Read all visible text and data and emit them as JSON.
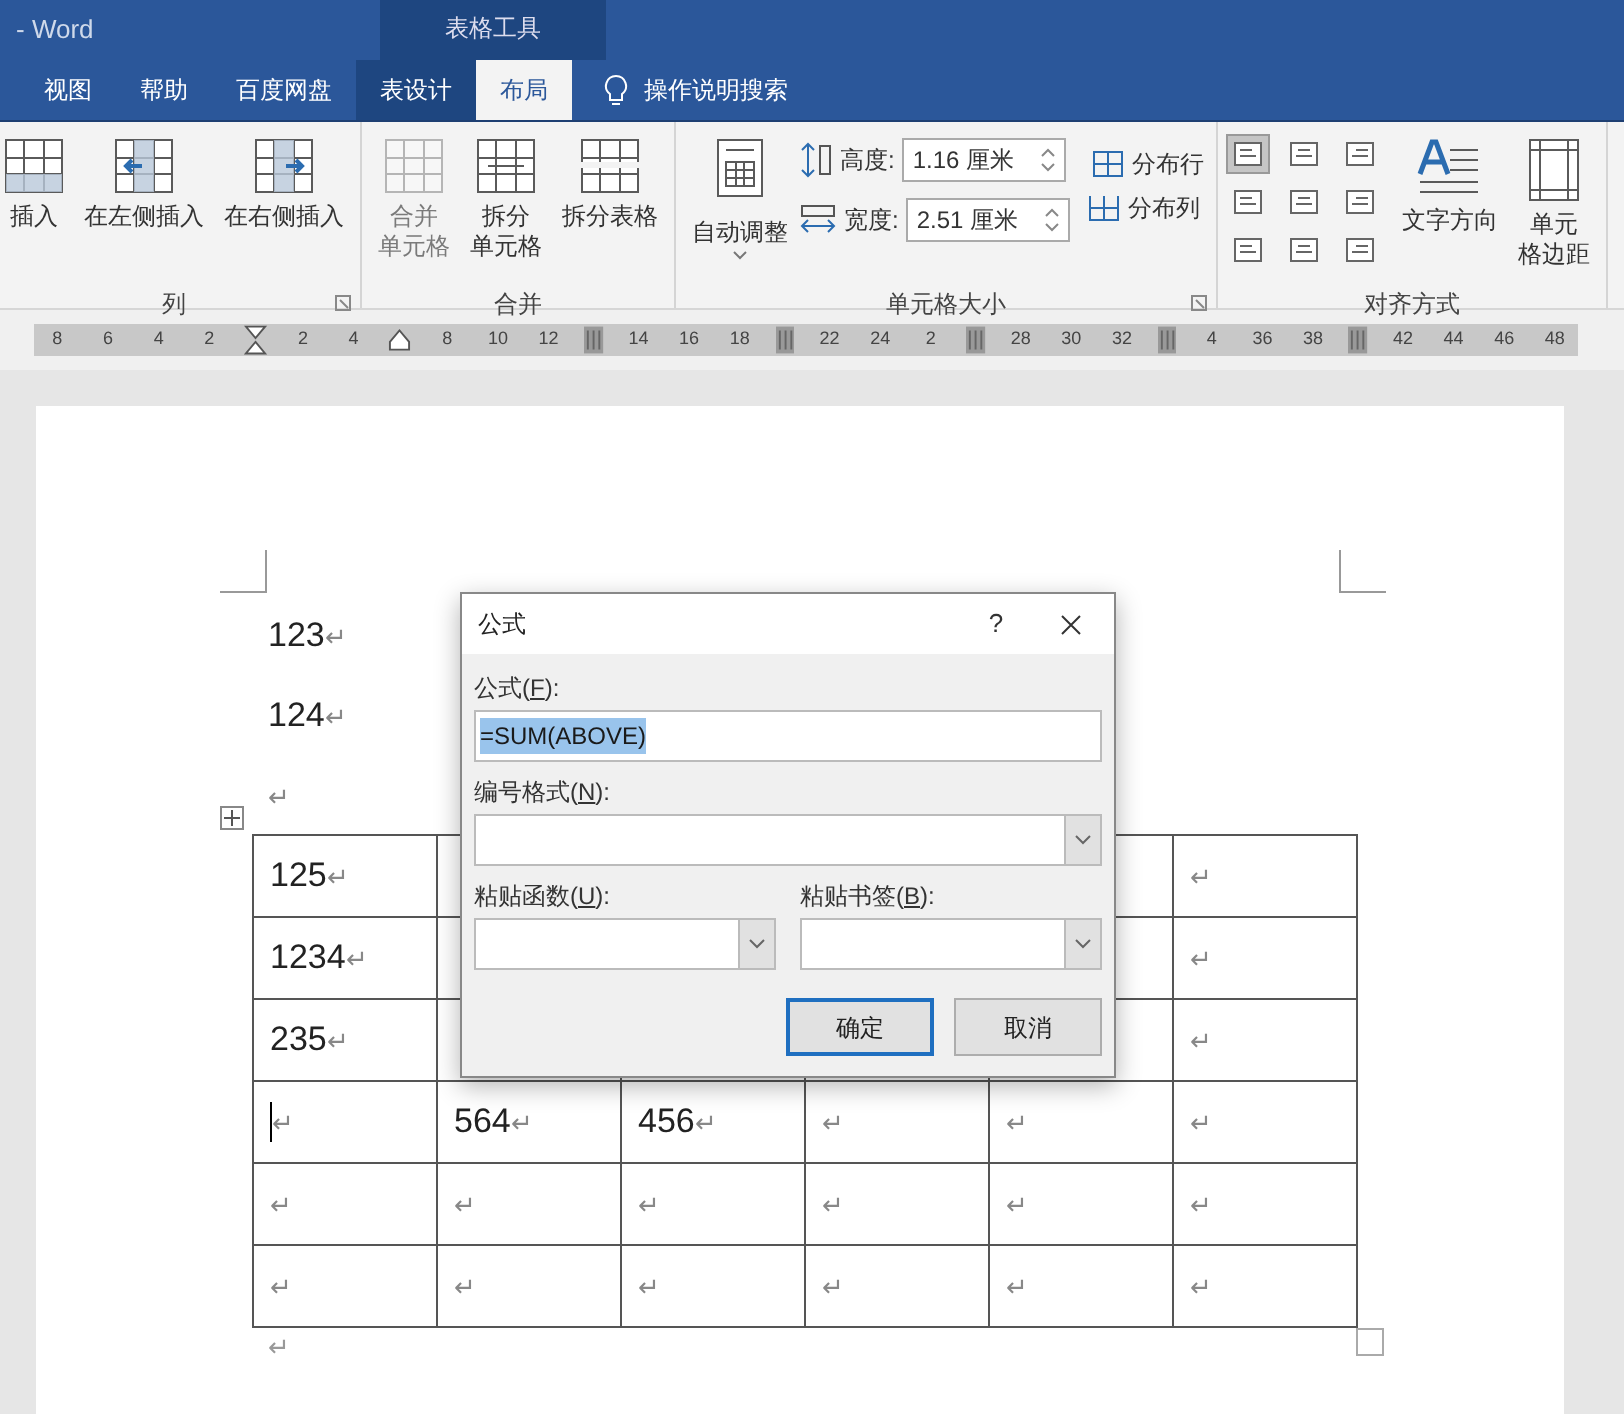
{
  "window": {
    "title": "- Word",
    "context_tab": "表格工具"
  },
  "tabs": [
    {
      "label": "视图",
      "selected": false
    },
    {
      "label": "帮助",
      "selected": false
    },
    {
      "label": "百度网盘",
      "selected": false
    },
    {
      "label": "表设计",
      "selected": false
    },
    {
      "label": "布局",
      "selected": true
    }
  ],
  "search": {
    "label": "操作说明搜索"
  },
  "ribbon": {
    "groups": [
      {
        "label": "列",
        "launcher": true,
        "items": [
          {
            "kind": "big",
            "lines": [
              "插入"
            ],
            "disabled": false
          },
          {
            "kind": "big",
            "lines": [
              "在左侧插入"
            ],
            "disabled": false
          },
          {
            "kind": "big",
            "lines": [
              "在右侧插入"
            ],
            "disabled": false
          }
        ]
      },
      {
        "label": "合并",
        "launcher": false,
        "items": [
          {
            "kind": "big",
            "lines": [
              "合并",
              "单元格"
            ],
            "disabled": true
          },
          {
            "kind": "big",
            "lines": [
              "拆分",
              "单元格"
            ],
            "disabled": false
          },
          {
            "kind": "big",
            "lines": [
              "拆分表格"
            ],
            "disabled": false
          }
        ]
      },
      {
        "label": "单元格大小",
        "launcher": true,
        "items": [
          {
            "kind": "dropdown",
            "label": "自动调整",
            "disabled": false
          },
          {
            "kind": "spinner",
            "label": "高度:",
            "value": "1.16 厘米"
          },
          {
            "kind": "spinner",
            "label": "宽度:",
            "value": "2.51 厘米"
          },
          {
            "kind": "small",
            "label": "分布行",
            "disabled": false
          },
          {
            "kind": "small",
            "label": "分布列",
            "disabled": false
          }
        ]
      },
      {
        "label": "对齐方式",
        "launcher": false,
        "items": [
          {
            "kind": "align",
            "cells": [
              true,
              false,
              false,
              false,
              false,
              false,
              false,
              false,
              false
            ]
          },
          {
            "kind": "big",
            "lines": [
              "文字方向"
            ],
            "disabled": false
          },
          {
            "kind": "big",
            "lines": [
              "单元",
              "格边距"
            ],
            "disabled": false
          }
        ]
      }
    ]
  },
  "ruler": [
    {
      "kind": "num",
      "text": "8"
    },
    {
      "kind": "num",
      "text": "6"
    },
    {
      "kind": "num",
      "text": "4"
    },
    {
      "kind": "num",
      "text": "2"
    },
    {
      "kind": "indent"
    },
    {
      "kind": "num",
      "text": "2"
    },
    {
      "kind": "num",
      "text": "4"
    },
    {
      "kind": "tab"
    },
    {
      "kind": "num",
      "text": "8"
    },
    {
      "kind": "num",
      "text": "10"
    },
    {
      "kind": "num",
      "text": "12"
    },
    {
      "kind": "col"
    },
    {
      "kind": "num",
      "text": "14"
    },
    {
      "kind": "num",
      "text": "16"
    },
    {
      "kind": "num",
      "text": "18"
    },
    {
      "kind": "col"
    },
    {
      "kind": "num",
      "text": "22"
    },
    {
      "kind": "num",
      "text": "24"
    },
    {
      "kind": "num",
      "text": "2"
    },
    {
      "kind": "col"
    },
    {
      "kind": "num",
      "text": "28"
    },
    {
      "kind": "num",
      "text": "30"
    },
    {
      "kind": "num",
      "text": "32"
    },
    {
      "kind": "col"
    },
    {
      "kind": "num",
      "text": "4"
    },
    {
      "kind": "num",
      "text": "36"
    },
    {
      "kind": "num",
      "text": "38"
    },
    {
      "kind": "col"
    },
    {
      "kind": "num",
      "text": "42"
    },
    {
      "kind": "num",
      "text": "44"
    },
    {
      "kind": "num",
      "text": "46"
    },
    {
      "kind": "num",
      "text": "48"
    }
  ],
  "document": {
    "paragraphs": [
      {
        "text": "123",
        "mark": "↵"
      },
      {
        "text": "124",
        "mark": "↵"
      },
      {
        "mark": "↵"
      }
    ],
    "table": {
      "rows": [
        {
          "cells": [
            {
              "text": "125",
              "mark": "↵"
            },
            {},
            {},
            {},
            {},
            {
              "mark": "↵"
            }
          ]
        },
        {
          "cells": [
            {
              "text": "1234",
              "mark": "↵"
            },
            {},
            {},
            {},
            {},
            {
              "mark": "↵"
            }
          ]
        },
        {
          "cells": [
            {
              "text": "235",
              "mark": "↵"
            },
            {},
            {},
            {},
            {},
            {
              "mark": "↵"
            }
          ]
        },
        {
          "cells": [
            {
              "mark": "↵",
              "caret": true
            },
            {
              "text": "564",
              "mark": "↵"
            },
            {
              "text": "456",
              "mark": "↵"
            },
            {
              "mark": "↵"
            },
            {
              "mark": "↵"
            },
            {
              "mark": "↵"
            }
          ]
        },
        {
          "cells": [
            {
              "mark": "↵"
            },
            {
              "mark": "↵"
            },
            {
              "mark": "↵"
            },
            {
              "mark": "↵"
            },
            {
              "mark": "↵"
            },
            {
              "mark": "↵"
            }
          ]
        },
        {
          "cells": [
            {
              "mark": "↵"
            },
            {
              "mark": "↵"
            },
            {
              "mark": "↵"
            },
            {
              "mark": "↵"
            },
            {
              "mark": "↵"
            },
            {
              "mark": "↵"
            }
          ]
        }
      ]
    },
    "after_table": {
      "mark": "↵"
    }
  },
  "dialog": {
    "title": "公式",
    "help": "?",
    "formula": {
      "prefix": "公式(",
      "key": "F",
      "suffix": "):",
      "value": "=SUM(ABOVE)",
      "selected": true
    },
    "number_format": {
      "prefix": "编号格式(",
      "key": "N",
      "suffix": "):"
    },
    "paste_function": {
      "prefix": "粘贴函数(",
      "key": "U",
      "suffix": "):"
    },
    "paste_bookmark": {
      "prefix": "粘贴书签(",
      "key": "B",
      "suffix": "):"
    },
    "buttons": [
      {
        "label": "确定",
        "default": true
      },
      {
        "label": "取消",
        "default": false
      }
    ]
  }
}
